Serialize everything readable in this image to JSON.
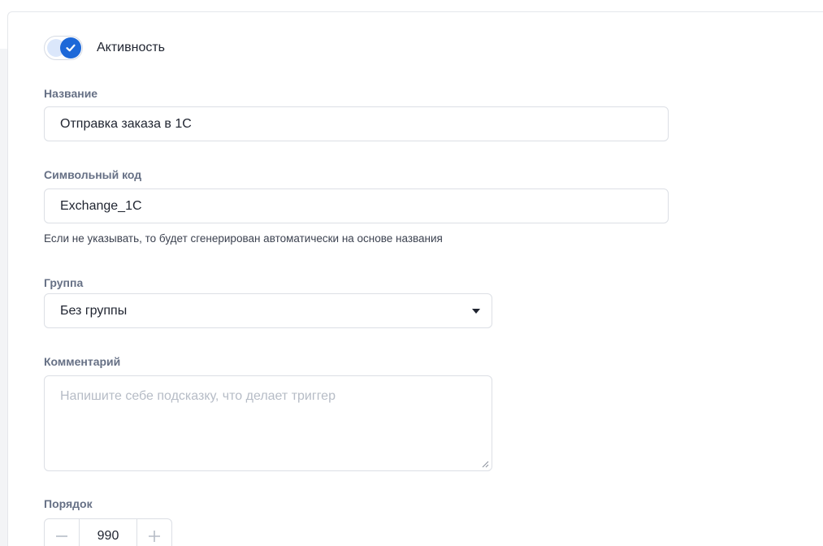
{
  "activity": {
    "label": "Активность",
    "checked": true,
    "accent_color": "#1d68d8"
  },
  "name_field": {
    "label": "Название",
    "value": "Отправка заказа в 1С"
  },
  "code_field": {
    "label": "Символьный код",
    "value": "Exchange_1C",
    "hint": "Если не указывать, то будет сгенерирован автоматически на основе названия"
  },
  "group_field": {
    "label": "Группа",
    "selected": "Без группы",
    "icon": "caret-down-icon"
  },
  "comment_field": {
    "label": "Комментарий",
    "value": "",
    "placeholder": "Напишите себе подсказку, что делает триггер"
  },
  "order_field": {
    "label": "Порядок",
    "value": "990",
    "decrement_icon": "minus-icon",
    "increment_icon": "plus-icon"
  }
}
